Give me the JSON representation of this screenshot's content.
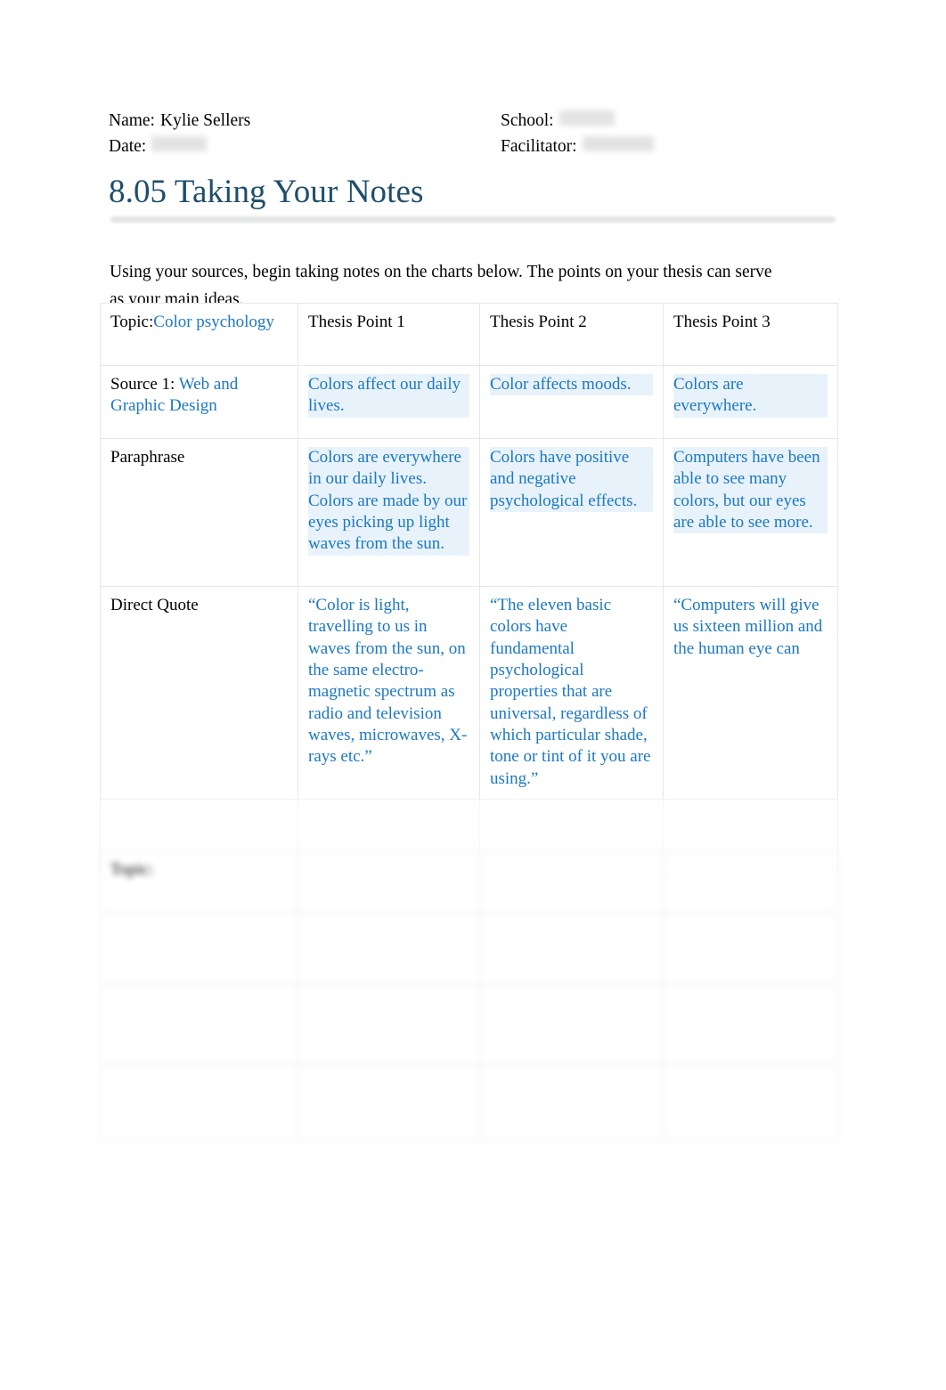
{
  "document": {
    "title": "8.05 Taking Your Notes",
    "intro": "Using your sources, begin taking notes on the charts below. The points on your thesis can serve as your main ideas."
  },
  "header": {
    "name_label": "Name:",
    "name_value": "Kylie Sellers",
    "date_label": "Date:",
    "date_value": "",
    "school_label": "School:",
    "school_value": "",
    "facilitator_label": "Facilitator:",
    "facilitator_value": ""
  },
  "colors": {
    "title": "#1f4e6b",
    "entry_text": "#1b78c4",
    "label_text": "#000000",
    "table_border": "#e6e7e8",
    "rule": "#e3e5e4"
  },
  "table_one": {
    "header": {
      "topic_label": "Topic:",
      "topic_value": "Color psychology",
      "thesis_point_1": "Thesis Point 1",
      "thesis_point_2": "Thesis Point 2",
      "thesis_point_3": "Thesis Point 3"
    },
    "rows": [
      {
        "label": "Source 1:",
        "label_value": "Web and Graphic Design",
        "cells": [
          "Colors affect our daily lives.",
          "Color affects moods.",
          "Colors are everywhere."
        ]
      },
      {
        "label": "Paraphrase",
        "label_value": "",
        "cells": [
          "Colors are everywhere in our daily lives. Colors are made by our eyes picking up light waves from the sun.",
          "Colors have positive and negative psychological effects.",
          "Computers have been able to see many colors, but our eyes are able to see more."
        ]
      },
      {
        "label": "Direct Quote",
        "label_value": "",
        "cells": [
          "“Color is light, travelling to us in waves from the sun, on the same electro-magnetic spectrum as radio and television waves, microwaves, X-rays etc.”",
          "“The eleven basic colors have fundamental psychological properties that are universal, regardless of which particular shade, tone or tint of it you are using.”",
          "“Computers will give us sixteen million and the human eye can"
        ]
      },
      {
        "label": "",
        "label_value": "",
        "cells": [
          "",
          "",
          ""
        ]
      }
    ]
  },
  "table_two": {
    "header": {
      "topic_label": "Topic:",
      "topic_value": "",
      "thesis_point_1": "",
      "thesis_point_2": "",
      "thesis_point_3": ""
    },
    "rows": [
      {
        "label": "",
        "label_value": "",
        "cells": [
          "",
          "",
          ""
        ]
      },
      {
        "label": "",
        "label_value": "",
        "cells": [
          "",
          "",
          ""
        ]
      },
      {
        "label": "",
        "label_value": "",
        "cells": [
          "",
          "",
          ""
        ]
      }
    ]
  }
}
